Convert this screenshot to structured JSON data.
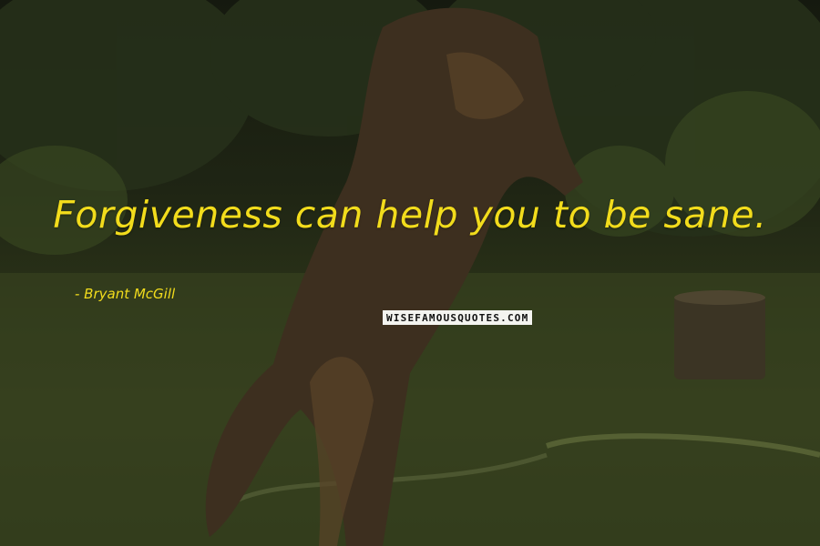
{
  "quote": {
    "text": "Forgiveness can help you to be sane."
  },
  "author": {
    "text": "- Bryant McGill"
  },
  "watermark": {
    "text": "WISEFAMOUSQUOTES.COM"
  },
  "colors": {
    "text": "#f2dc1c",
    "watermark_bg": "#f4f4f0"
  },
  "image": {
    "subject_icon": "jumping-dog-photo"
  }
}
